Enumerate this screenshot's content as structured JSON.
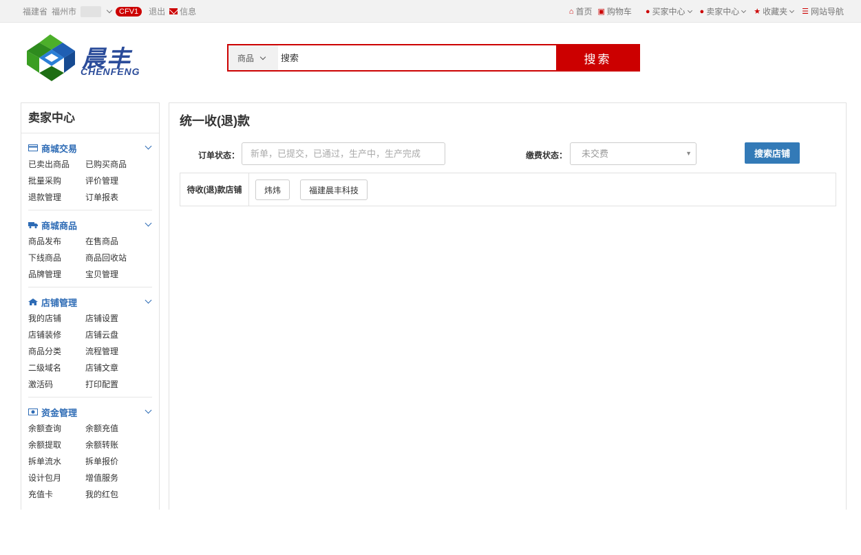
{
  "topbar": {
    "province": "福建省",
    "city": "福州市",
    "vip_badge": "CFV1",
    "logout": "退出",
    "messages": "信息",
    "nav": [
      {
        "icon": "home-icon",
        "label": "首页"
      },
      {
        "icon": "cart-icon",
        "label": "购物车"
      },
      {
        "icon": "user-icon",
        "label": "买家中心"
      },
      {
        "icon": "user-icon",
        "label": "卖家中心"
      },
      {
        "icon": "star-icon",
        "label": "收藏夹"
      },
      {
        "icon": "list-icon",
        "label": "网站导航"
      }
    ]
  },
  "brand": {
    "name_cn": "晨丰",
    "name_en": "CHENFENG"
  },
  "search": {
    "category": "商品",
    "placeholder": "搜索",
    "button": "搜索"
  },
  "sidebar": {
    "title": "卖家中心",
    "sections": [
      {
        "title": "商城交易",
        "icon": "card-icon",
        "links": [
          "已卖出商品",
          "已购买商品",
          "批量采购",
          "评价管理",
          "退款管理",
          "订单报表"
        ]
      },
      {
        "title": "商城商品",
        "icon": "truck-icon",
        "links": [
          "商品发布",
          "在售商品",
          "下线商品",
          "商品回收站",
          "品牌管理",
          "宝贝管理"
        ]
      },
      {
        "title": "店铺管理",
        "icon": "home-icon",
        "links": [
          "我的店铺",
          "店铺设置",
          "店铺装修",
          "店铺云盘",
          "商品分类",
          "流程管理",
          "二级域名",
          "店铺文章",
          "激活码",
          "打印配置"
        ]
      },
      {
        "title": "资金管理",
        "icon": "money-icon",
        "links": [
          "余额查询",
          "余额充值",
          "余额提取",
          "余额转账",
          "拆单流水",
          "拆单报价",
          "设计包月",
          "增值服务",
          "充值卡",
          "我的红包"
        ]
      }
    ]
  },
  "main": {
    "title": "统一收(退)款",
    "order_status_label": "订单状态：",
    "order_status_placeholder": "新单，已提交，已通过，生产中，生产完成",
    "payment_status_label": "缴费状态：",
    "payment_status_value": "未交费",
    "search_store_button": "搜索店铺",
    "pending_label": "待收(退)款店铺",
    "stores": [
      "炜炜",
      "福建晨丰科技"
    ]
  },
  "colors": {
    "accent_red": "#cc0000",
    "link_blue": "#2d6bb5",
    "button_blue": "#337ab7"
  }
}
